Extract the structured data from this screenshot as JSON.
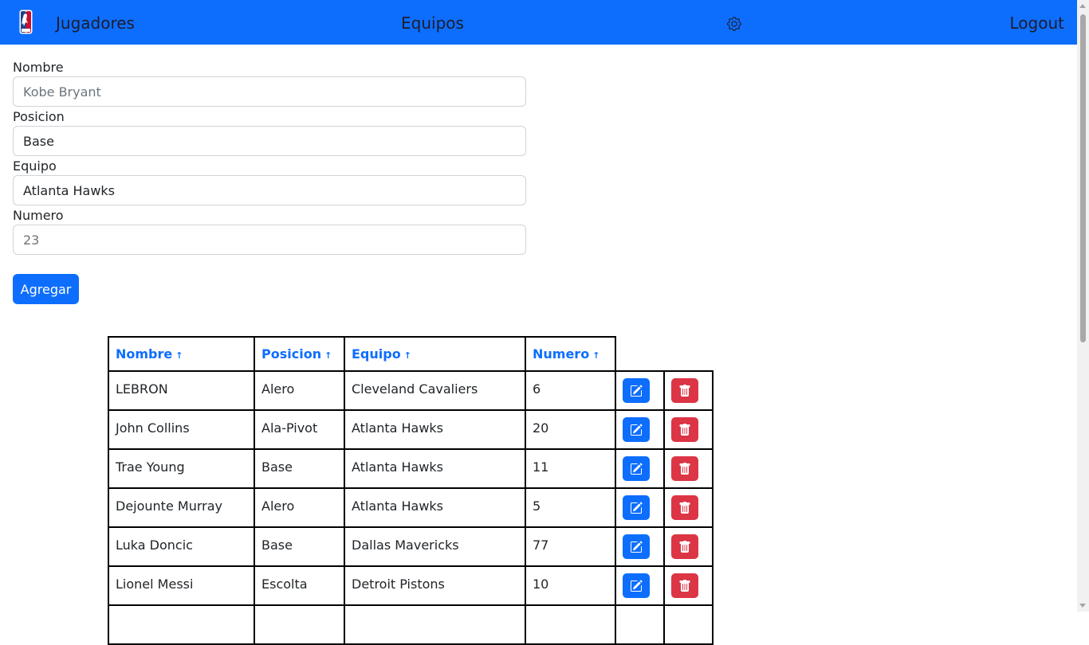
{
  "navbar": {
    "logo_icon": "nba-logo-icon",
    "players": "Jugadores",
    "teams": "Equipos",
    "settings_icon": "gear-icon",
    "logout": "Logout",
    "background": "#0d6efd"
  },
  "form": {
    "name_label": "Nombre",
    "name_placeholder": "Kobe Bryant",
    "position_label": "Posicion",
    "position_value": "Base",
    "team_label": "Equipo",
    "team_value": "Atlanta Hawks",
    "number_label": "Numero",
    "number_placeholder": "23",
    "submit_label": "Agregar"
  },
  "table": {
    "headers": [
      "Nombre",
      "Posicion",
      "Equipo",
      "Numero"
    ],
    "sort_icon": "sort-up-arrow-icon",
    "edit_icon": "edit-icon",
    "delete_icon": "trash-icon",
    "rows": [
      {
        "name": "LEBRON",
        "position": "Alero",
        "team": "Cleveland Cavaliers",
        "number": "6"
      },
      {
        "name": "John Collins",
        "position": "Ala-Pivot",
        "team": "Atlanta Hawks",
        "number": "20"
      },
      {
        "name": "Trae Young",
        "position": "Base",
        "team": "Atlanta Hawks",
        "number": "11"
      },
      {
        "name": "Dejounte Murray",
        "position": "Alero",
        "team": "Atlanta Hawks",
        "number": "5"
      },
      {
        "name": "Luka Doncic",
        "position": "Base",
        "team": "Dallas Mavericks",
        "number": "77"
      },
      {
        "name": "Lionel Messi",
        "position": "Escolta",
        "team": "Detroit Pistons",
        "number": "10"
      }
    ]
  },
  "colors": {
    "primary": "#0d6efd",
    "danger": "#dc3545"
  }
}
